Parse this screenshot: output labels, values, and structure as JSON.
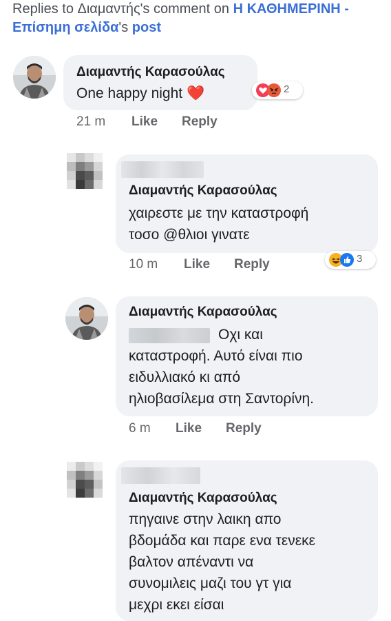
{
  "header": {
    "prefix": "Replies to Διαμαντής's comment on ",
    "page_name": "Η ΚΑΘΗΜΕΡΙΝΗ - Επίσημη σελίδα",
    "suffix_pre": "'s ",
    "post_link": "post"
  },
  "comments": [
    {
      "name": "Διαμαντής Καρασούλας",
      "text": "One happy night ❤️",
      "time": "21 m",
      "like": "Like",
      "reply": "Reply",
      "reaction_count": "2",
      "reaction_icons": [
        "love-icon",
        "angry-icon"
      ]
    },
    {
      "name": "Διαμαντής Καρασούλας",
      "lines": [
        "χαιρεστε με την καταστροφή",
        "τοσο @θλιοι γινατε"
      ],
      "time": "10 m",
      "like": "Like",
      "reply": "Reply",
      "reaction_count": "3",
      "reaction_icons": [
        "haha-icon",
        "like-icon"
      ]
    },
    {
      "name": "Διαμαντής Καρασούλας",
      "lines": [
        "Οχι και",
        "καταστροφή. Αυτό είναι πιο",
        "ειδυλλιακό κι από",
        "ηλιοβασίλεμα στη Σαντορίνη."
      ],
      "time": "6 m",
      "like": "Like",
      "reply": "Reply"
    },
    {
      "name": "Διαμαντής Καρασούλας",
      "lines": [
        "πηγαινε στην λαικη απο",
        "βδομάδα και παρε ενα τενεκε",
        "βαλτον απέναντι να",
        "συνομιλεις μαζι του γτ για",
        "μεχρι εκει είσαι"
      ]
    }
  ],
  "colors": {
    "link": "#3b6fd6",
    "bubble": "#f0f2f5",
    "meta": "#65676b",
    "love": "#f33e58",
    "angry": "#e8593c",
    "like": "#1877f2",
    "haha": "#f7b125"
  }
}
